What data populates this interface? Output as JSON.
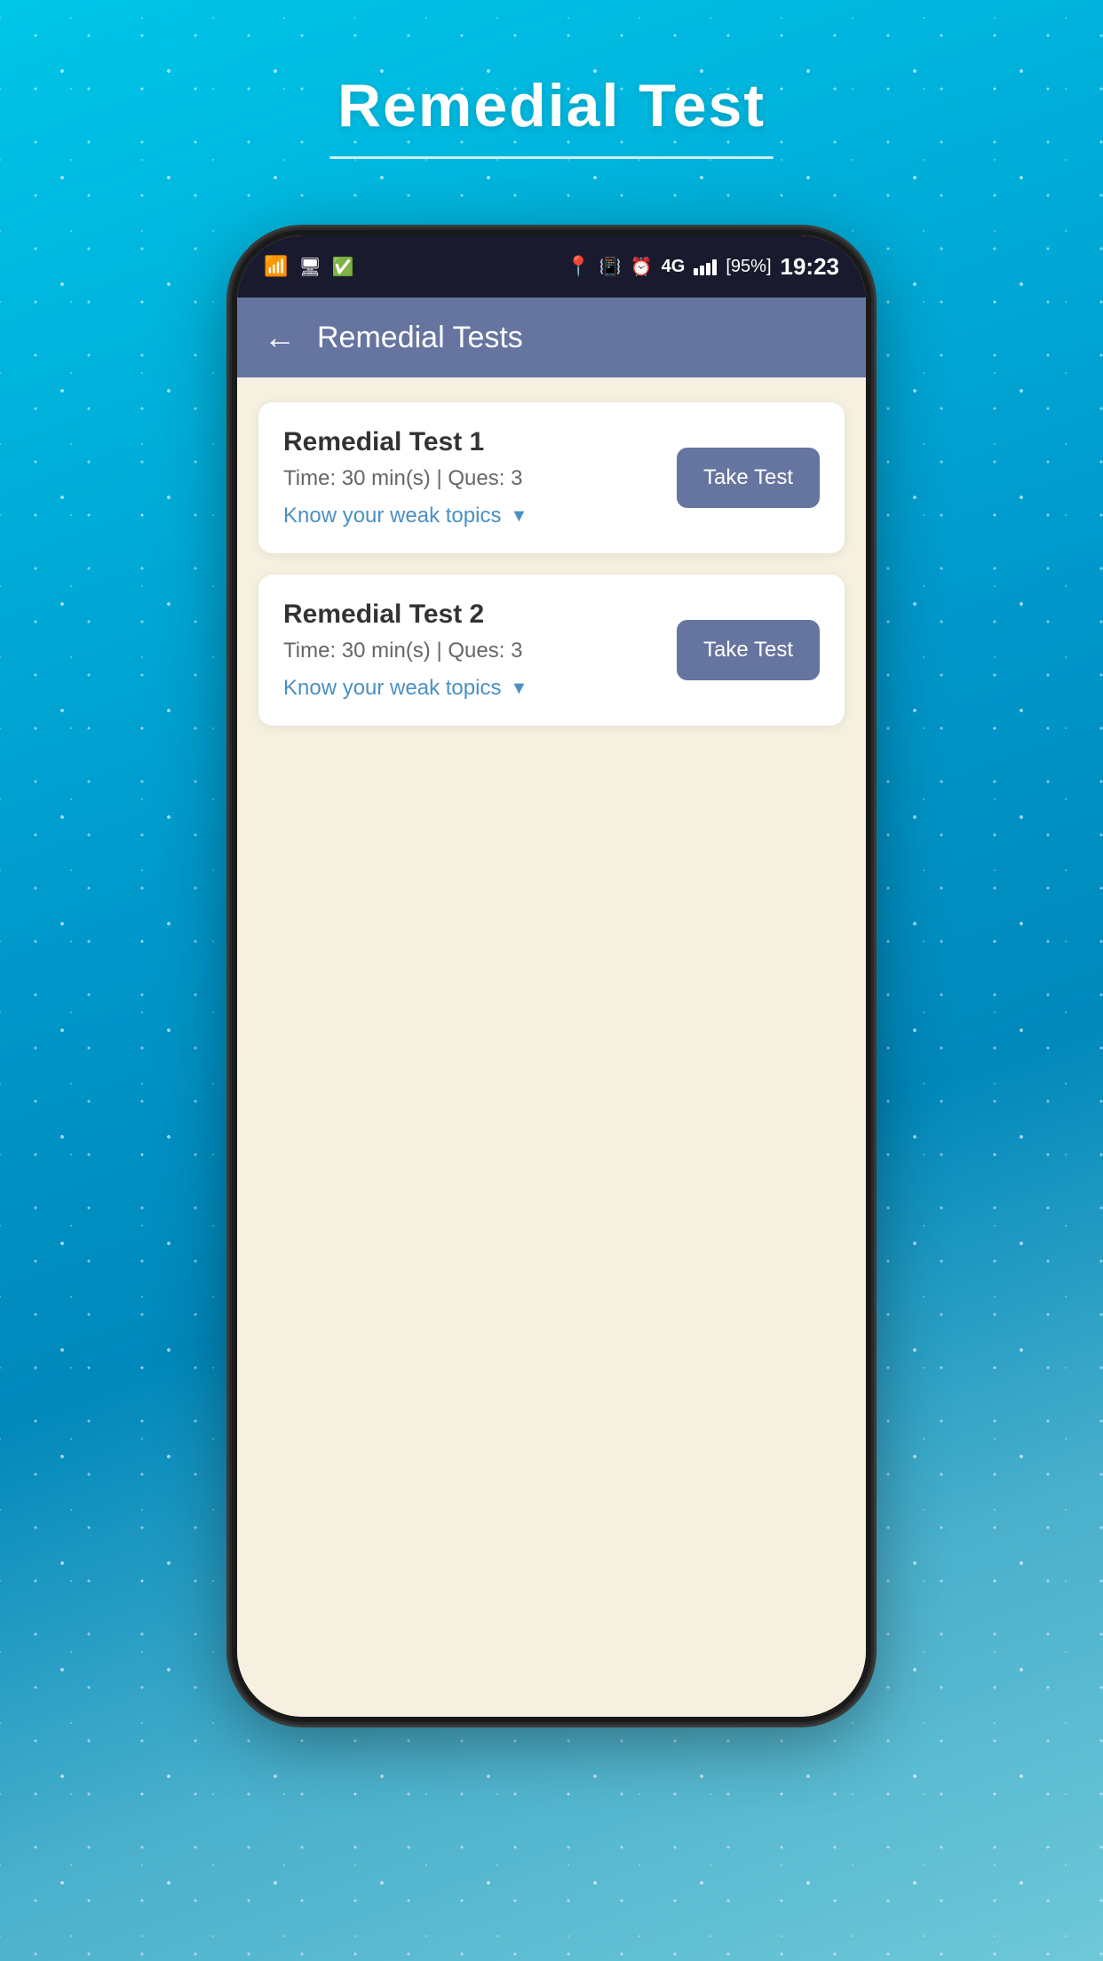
{
  "page": {
    "title": "Remedial Test",
    "title_underline": true,
    "background_color": "#00c6e8"
  },
  "status_bar": {
    "time": "19:23",
    "battery_percent": "95%",
    "network": "4G",
    "signal_bars": 4
  },
  "app_header": {
    "back_label": "←",
    "title": "Remedial Tests",
    "background_color": "#6674a0"
  },
  "tests": [
    {
      "id": 1,
      "title": "Remedial Test 1",
      "meta": "Time: 30 min(s) | Ques: 3",
      "know_weak_topics_label": "Know your weak topics",
      "take_test_label": "Take Test"
    },
    {
      "id": 2,
      "title": "Remedial Test 2",
      "meta": "Time: 30 min(s) | Ques: 3",
      "know_weak_topics_label": "Know your weak topics",
      "take_test_label": "Take Test"
    }
  ],
  "colors": {
    "accent": "#6674a0",
    "link": "#4a90c4",
    "background": "#f5f0e0",
    "card_bg": "#ffffff"
  }
}
